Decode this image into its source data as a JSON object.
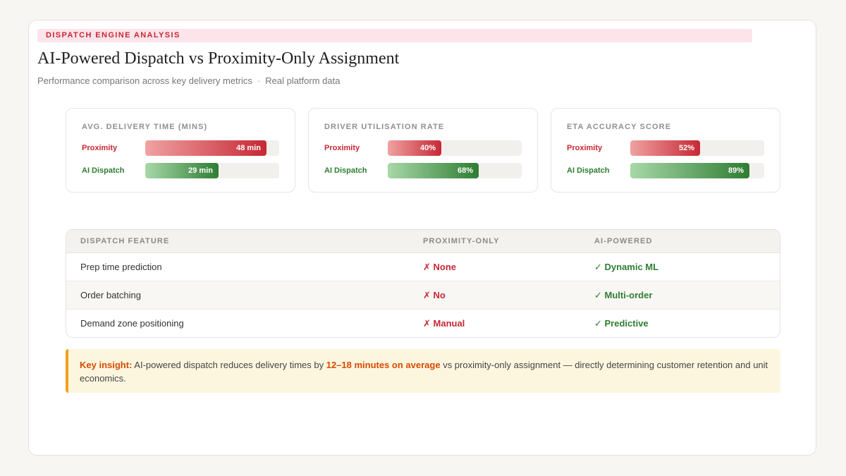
{
  "header": {
    "eyebrow": "DISPATCH ENGINE ANALYSIS",
    "title": "AI-Powered Dispatch vs Proximity-Only Assignment",
    "subtitle_left": "Performance comparison across key delivery metrics",
    "subtitle_sep": "·",
    "subtitle_right": "Real platform data"
  },
  "colors": {
    "proximity": "#c62834",
    "ai": "#2e7d32",
    "accent": "#f0a020"
  },
  "chart_data": [
    {
      "type": "bar",
      "title": "AVG. DELIVERY TIME (MINS)",
      "categories": [
        "Proximity",
        "AI Dispatch"
      ],
      "values": [
        48,
        29
      ],
      "value_labels": [
        "48 min",
        "29 min"
      ],
      "xlim": [
        0,
        53
      ]
    },
    {
      "type": "bar",
      "title": "DRIVER UTILISATION RATE",
      "categories": [
        "Proximity",
        "AI Dispatch"
      ],
      "values": [
        40,
        68
      ],
      "value_labels": [
        "40%",
        "68%"
      ],
      "xlim": [
        0,
        100
      ]
    },
    {
      "type": "bar",
      "title": "ETA ACCURACY SCORE",
      "categories": [
        "Proximity",
        "AI Dispatch"
      ],
      "values": [
        52,
        89
      ],
      "value_labels": [
        "52%",
        "89%"
      ],
      "xlim": [
        0,
        100
      ]
    }
  ],
  "table": {
    "headers": [
      "DISPATCH FEATURE",
      "PROXIMITY-ONLY",
      "AI-POWERED"
    ],
    "rows": [
      [
        "Prep time prediction",
        "✗ None",
        "✓ Dynamic ML"
      ],
      [
        "Order batching",
        "✗ No",
        "✓ Multi-order"
      ],
      [
        "Demand zone positioning",
        "✗ Manual",
        "✓ Predictive"
      ]
    ]
  },
  "insight": {
    "lead": "Key insight:",
    "text_a": " AI-powered dispatch reduces delivery times by ",
    "highlight": "12–18 minutes on average",
    "text_b": " vs proximity-only assignment — directly determining customer retention and unit economics."
  }
}
